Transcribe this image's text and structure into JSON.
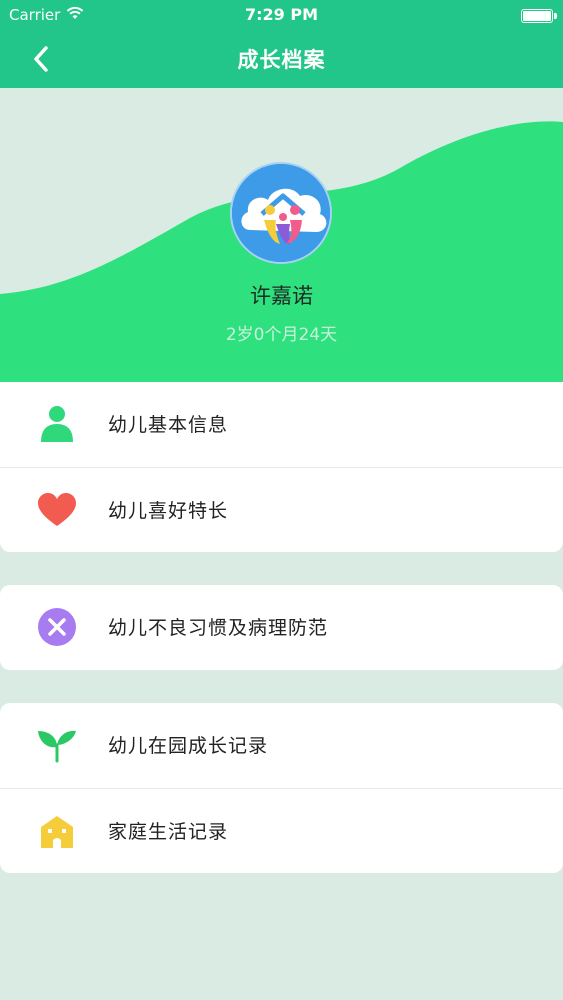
{
  "status_bar": {
    "carrier": "Carrier",
    "time": "7:29 PM"
  },
  "nav": {
    "title": "成长档案",
    "back_icon": "chevron-left-icon"
  },
  "profile": {
    "name": "许嘉诺",
    "age": "2岁0个月24天"
  },
  "colors": {
    "accent": "#22c58a",
    "wave": "#2ee07e",
    "background": "#d9ebe2"
  },
  "menu_groups": [
    [
      {
        "label": "幼儿基本信息",
        "icon": "person-icon",
        "color": "#2fd87a"
      },
      {
        "label": "幼儿喜好特长",
        "icon": "heart-icon",
        "color": "#f25b4f"
      }
    ],
    [
      {
        "label": "幼儿不良习惯及病理防范",
        "icon": "x-circle-icon",
        "color": "#a77cf0"
      }
    ],
    [
      {
        "label": "幼儿在园成长记录",
        "icon": "sprout-icon",
        "color": "#2bc865"
      },
      {
        "label": "家庭生活记录",
        "icon": "house-icon",
        "color": "#f5cd3b"
      }
    ]
  ]
}
